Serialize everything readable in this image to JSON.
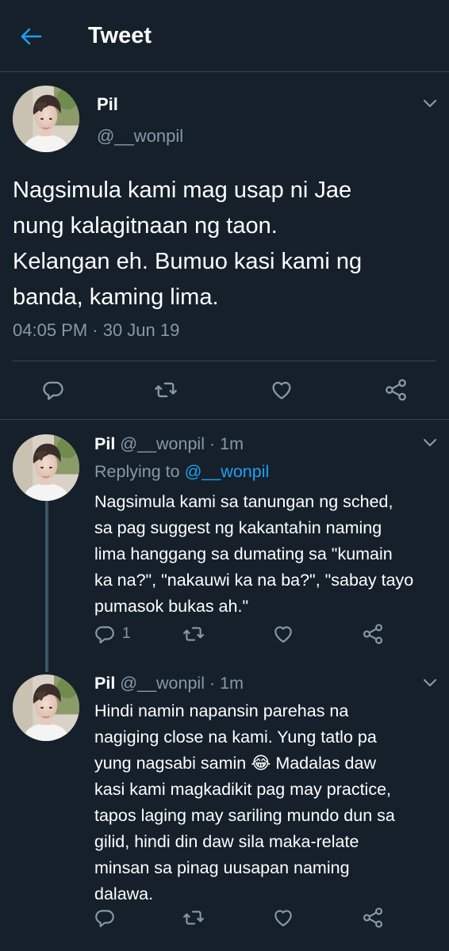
{
  "header": {
    "title": "Tweet"
  },
  "main_tweet": {
    "name": "Pil",
    "handle": "@__wonpil",
    "text": "Nagsimula kami mag usap ni Jae\nnung kalagitnaan ng taon.\nKelangan eh. Bumuo kasi kami ng\nbanda, kaming lima.",
    "timestamp": "04:05 PM · 30 Jun 19"
  },
  "replies": [
    {
      "name": "Pil",
      "handle": "@__wonpil",
      "separator": "·",
      "time": "1m",
      "replying_to_label": "Replying to",
      "replying_to_handle": "@__wonpil",
      "text": "Nagsimula kami sa tanungan ng sched,\nsa pag suggest ng kakantahin naming\nlima hanggang sa dumating sa \"kumain\nka na?\", \"nakauwi ka na ba?\", \"sabay tayo\npumasok bukas ah.\"",
      "reply_count": "1"
    },
    {
      "name": "Pil",
      "handle": "@__wonpil",
      "separator": "·",
      "time": "1m",
      "text_before_emoji": "Hindi namin napansin parehas na\nnagiging close na kami. Yung tatlo pa\nyung nagsabi samin ",
      "emoji": "😂",
      "text_after_emoji": " Madalas daw\nkasi kami magkadikit pag may practice,\ntapos laging may sariling mundo dun sa\ngilid, hindi din daw sila maka-relate\nminsan sa pinag uusapan naming\ndalawa."
    }
  ],
  "icons": {
    "back": "arrow-left-icon",
    "more": "chevron-down-icon",
    "reply": "reply-icon",
    "retweet": "retweet-icon",
    "like": "heart-icon",
    "share": "share-icon"
  },
  "colors": {
    "background": "#15202b",
    "accent": "#1da1f2",
    "muted": "#8899a6",
    "divider": "#38444d",
    "thread_line": "#3d5466"
  }
}
